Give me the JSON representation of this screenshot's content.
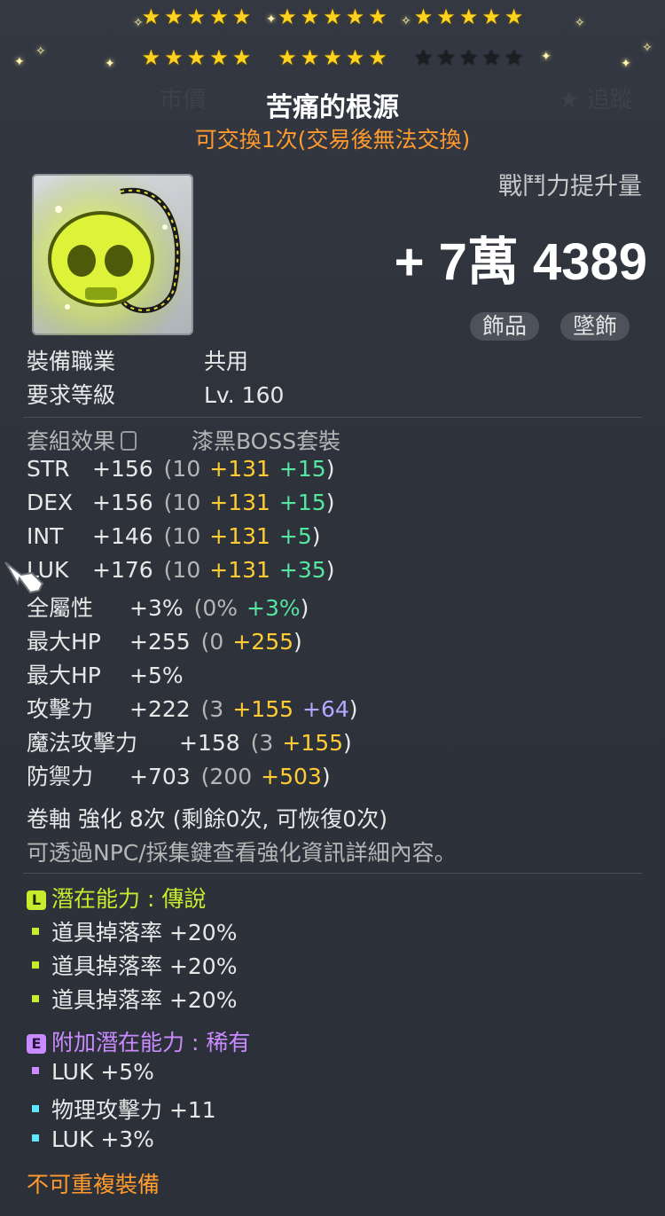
{
  "item": {
    "name": "苦痛的根源",
    "trade": "可交換1次(交易後無法交換)"
  },
  "stars": {
    "row1": [
      5,
      5,
      5
    ],
    "row2_on": 10,
    "row2_off": 5
  },
  "power": {
    "label": "戰鬥力提升量",
    "value": "+ 7萬 4389"
  },
  "tags": [
    "飾品",
    "墜飾"
  ],
  "requirements": [
    {
      "label": "裝備職業",
      "value": "共用"
    },
    {
      "label": "要求等級",
      "value": "Lv. 160"
    }
  ],
  "set": {
    "label": "套組效果",
    "value": "漆黑BOSS套裝"
  },
  "stats": [
    {
      "name": "STR",
      "total": "+156",
      "base": "(10",
      "a": "+131",
      "b": "+15",
      "b_color": "g",
      "end": ")"
    },
    {
      "name": "DEX",
      "total": "+156",
      "base": "(10",
      "a": "+131",
      "b": "+15",
      "b_color": "g",
      "end": ")"
    },
    {
      "name": "INT",
      "total": "+146",
      "base": "(10",
      "a": "+131",
      "b": "+5",
      "b_color": "g",
      "end": ")"
    },
    {
      "name": "LUK",
      "total": "+176",
      "base": "(10",
      "a": "+131",
      "b": "+35",
      "b_color": "g",
      "end": ")"
    },
    {
      "name": "全屬性",
      "total": "+3%",
      "base": "(0%",
      "a": "",
      "b": "+3%",
      "b_color": "g",
      "end": ")"
    },
    {
      "name": "最大HP",
      "total": "+255",
      "base": "(0",
      "a": "+255",
      "b": "",
      "b_color": "g",
      "end": ")"
    },
    {
      "name": "最大HP",
      "total": "+5%",
      "base": "",
      "a": "",
      "b": "",
      "b_color": "g",
      "end": ""
    },
    {
      "name": "攻擊力",
      "total": "+222",
      "base": "(3",
      "a": "+155",
      "b": "+64",
      "b_color": "p",
      "end": ")"
    },
    {
      "name": "魔法攻擊力",
      "total": "+158",
      "base": "(3",
      "a": "+155",
      "b": "",
      "b_color": "g",
      "end": ")"
    },
    {
      "name": "防禦力",
      "total": "+703",
      "base": "(200",
      "a": "+503",
      "b": "",
      "b_color": "g",
      "end": ")"
    }
  ],
  "scroll": {
    "line": "卷軸 強化 8次 (剩餘0次, 可恢復0次)",
    "hint": "可透過NPC/採集鍵查看強化資訊詳細內容。"
  },
  "potential": {
    "header": "潛在能力 : 傳說",
    "lines": [
      "道具掉落率 +20%",
      "道具掉落率 +20%",
      "道具掉落率 +20%"
    ]
  },
  "additional": {
    "header": "附加潛在能力 : 稀有",
    "lines": [
      "LUK +5%",
      "物理攻擊力 +11",
      "LUK +3%"
    ]
  },
  "footer": "不可重複裝備",
  "colors": {
    "gold": "#ffcc33",
    "green": "#55e6a0",
    "lime": "#c6ec2e",
    "purple": "#c98bff",
    "orange": "#ff9a2e"
  }
}
